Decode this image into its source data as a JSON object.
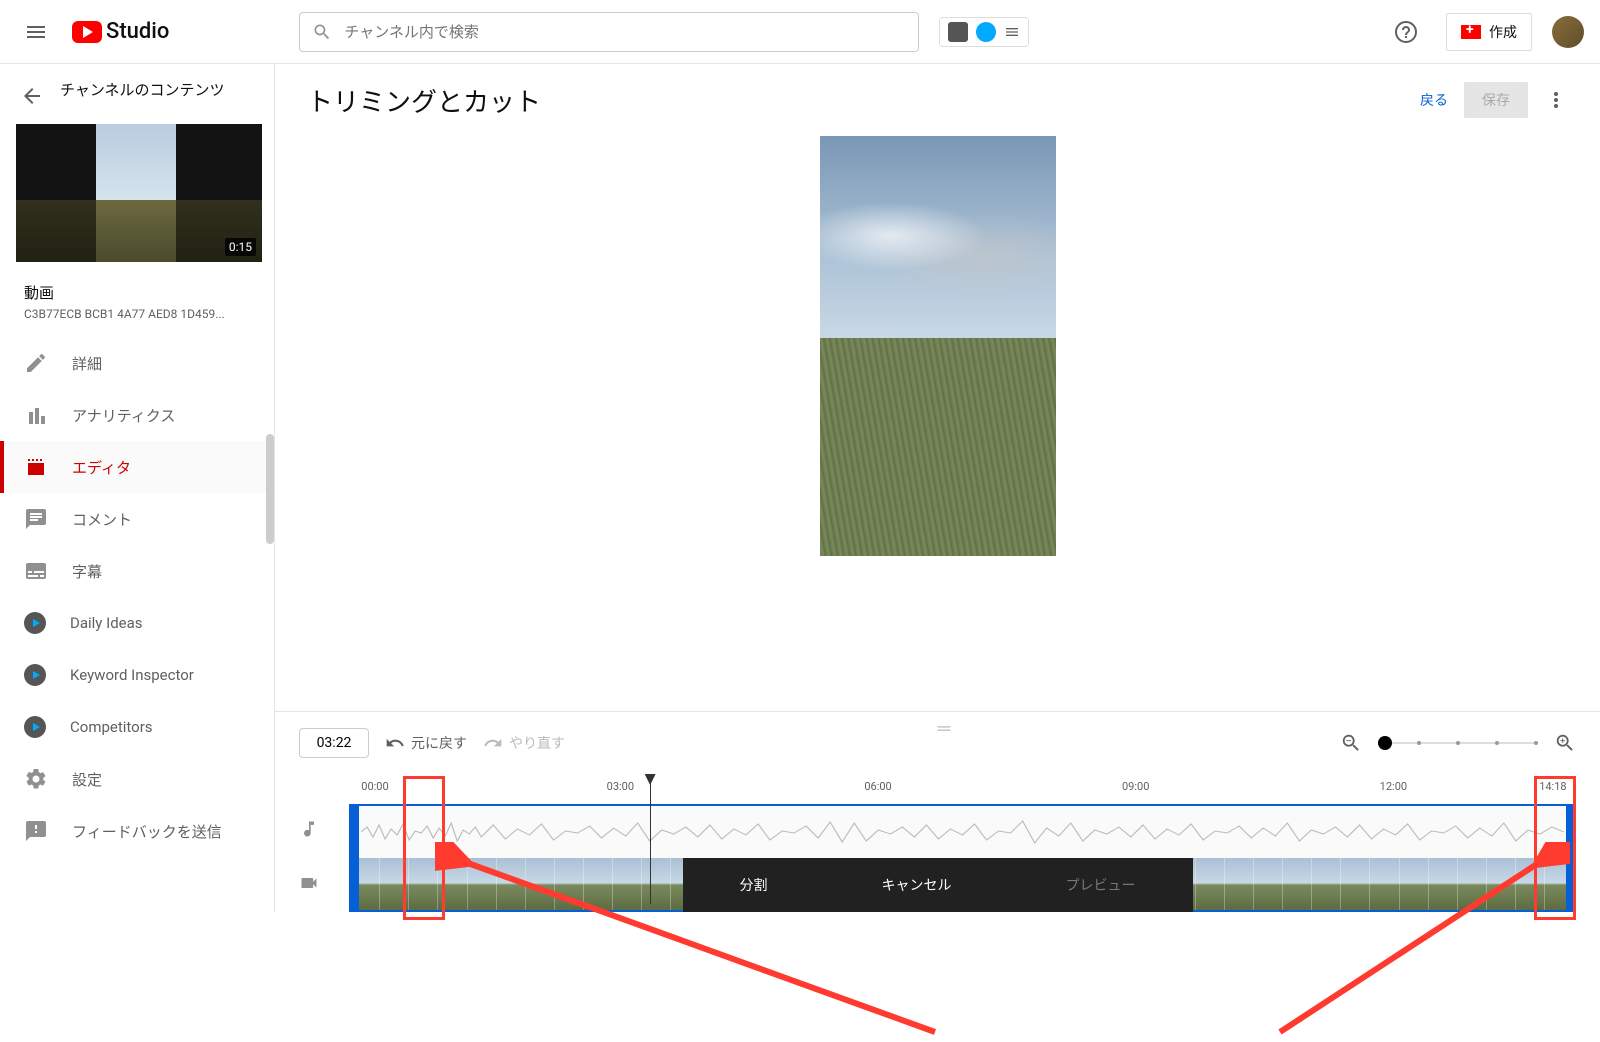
{
  "header": {
    "logo_text": "Studio",
    "search_placeholder": "チャンネル内で検索",
    "create_label": "作成"
  },
  "sidebar": {
    "content_label": "チャンネルのコンテンツ",
    "duration": "0:15",
    "video_label": "動画",
    "video_id": "C3B77ECB BCB1 4A77 AED8 1D459...",
    "items": [
      {
        "label": "詳細",
        "icon": "pencil"
      },
      {
        "label": "アナリティクス",
        "icon": "analytics"
      },
      {
        "label": "エディタ",
        "icon": "editor",
        "active": true
      },
      {
        "label": "コメント",
        "icon": "comments"
      },
      {
        "label": "字幕",
        "icon": "subtitles"
      },
      {
        "label": "Daily Ideas",
        "icon": "ext"
      },
      {
        "label": "Keyword Inspector",
        "icon": "ext"
      },
      {
        "label": "Competitors",
        "icon": "ext"
      }
    ],
    "settings_label": "設定",
    "feedback_label": "フィードバックを送信"
  },
  "main": {
    "title": "トリミングとカット",
    "back_label": "戻る",
    "save_label": "保存"
  },
  "timeline": {
    "current_time": "03:22",
    "undo_label": "元に戻す",
    "redo_label": "やり直す",
    "ruler": [
      "00:00",
      "03:00",
      "06:00",
      "09:00",
      "12:00",
      "14:18"
    ]
  },
  "bottom_bar": {
    "split": "分割",
    "cancel": "キャンセル",
    "preview": "プレビュー"
  }
}
